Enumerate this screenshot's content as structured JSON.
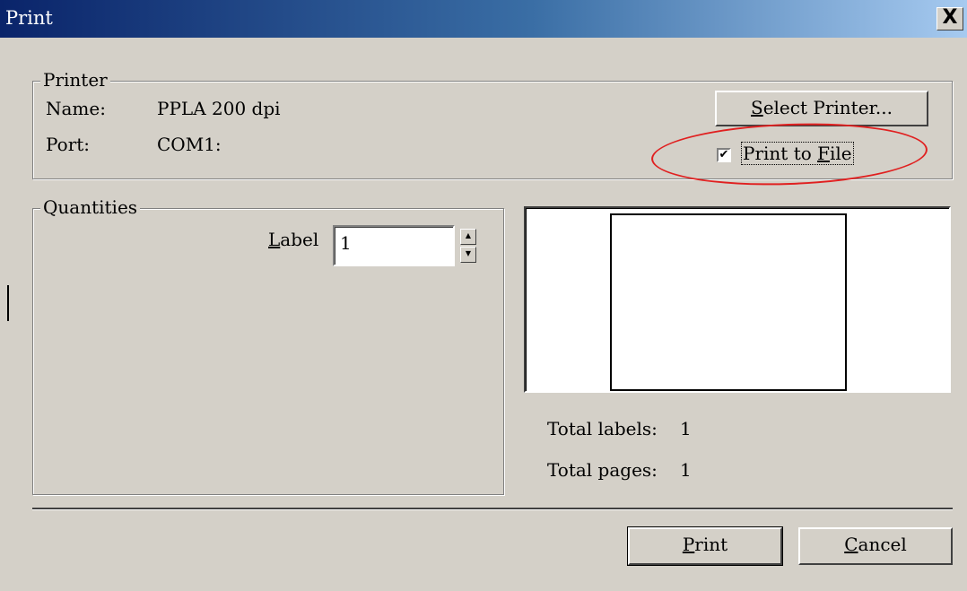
{
  "window": {
    "title": "Print",
    "close_glyph": "X"
  },
  "printer": {
    "group_label": "Printer",
    "name_label": "Name:",
    "name_value": "PPLA 200 dpi",
    "port_label": "Port:",
    "port_value": "COM1:",
    "select_printer_button": {
      "mnemonic": "S",
      "rest": "elect Printer..."
    },
    "print_to_file": {
      "checked": true,
      "prefix": "Print to ",
      "mnemonic": "F",
      "rest": "ile",
      "check_glyph": "✔"
    }
  },
  "quantities": {
    "group_label": "Quantities",
    "label_field": {
      "mnemonic": "L",
      "rest": "abel",
      "value": "1"
    }
  },
  "preview": {
    "total_labels_label": "Total labels:",
    "total_labels_value": "1",
    "total_pages_label": "Total pages:",
    "total_pages_value": "1"
  },
  "buttons": {
    "print": {
      "mnemonic": "P",
      "rest": "rint"
    },
    "cancel": {
      "mnemonic": "C",
      "rest": "ancel"
    }
  },
  "colors": {
    "annotation": "#e02020",
    "titlebar": "#0a246a",
    "face": "#d4d0c8"
  },
  "icons": {
    "close": "close-icon",
    "spin_up": "arrow-up-icon",
    "spin_down": "arrow-down-icon",
    "check": "checkmark-icon"
  }
}
